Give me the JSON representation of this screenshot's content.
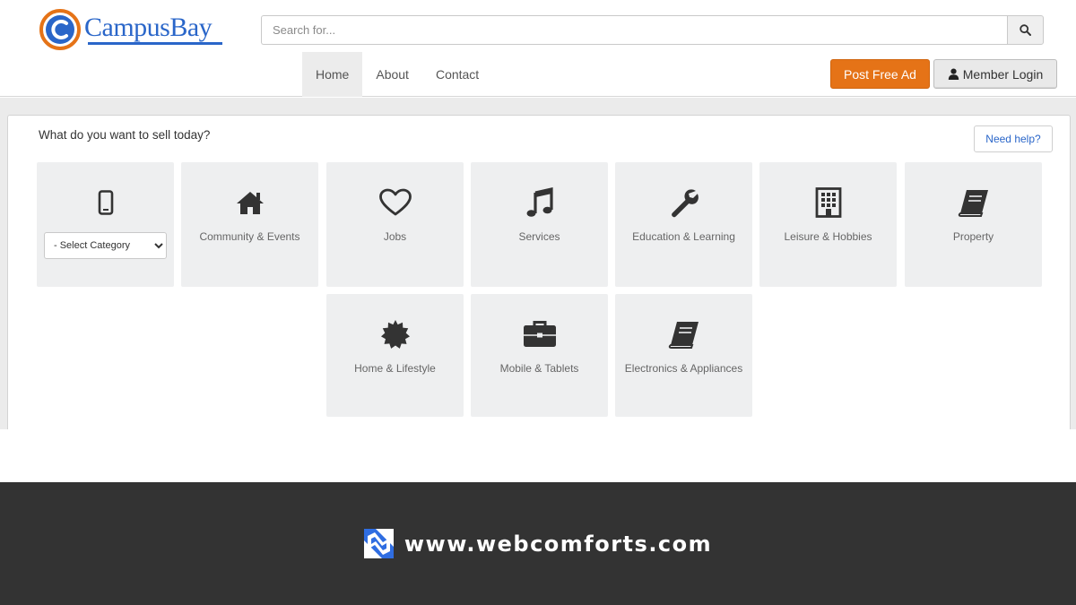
{
  "brand": {
    "logo_text": "CampusBay",
    "accent_color": "#2a66c9",
    "orange_color": "#e57317"
  },
  "search": {
    "placeholder": "Search for...",
    "icon": "search-icon"
  },
  "nav": {
    "items": [
      {
        "label": "Home",
        "active": true
      },
      {
        "label": "About",
        "active": false
      },
      {
        "label": "Contact",
        "active": false
      }
    ]
  },
  "actions": {
    "post_ad_label": "Post Free Ad",
    "member_login_label": "Member Login",
    "member_login_icon": "user-icon"
  },
  "panel": {
    "title": "What do you want to sell today?",
    "help_label": "Need help?"
  },
  "select_category": {
    "icon": "mobile-phone-icon",
    "selected": "- Select Category"
  },
  "categories": [
    {
      "label": "Community & Events",
      "icon": "home-icon"
    },
    {
      "label": "Jobs",
      "icon": "heart-icon"
    },
    {
      "label": "Services",
      "icon": "music-icon"
    },
    {
      "label": "Education & Learning",
      "icon": "wrench-icon"
    },
    {
      "label": "Leisure & Hobbies",
      "icon": "building-icon"
    },
    {
      "label": "Property",
      "icon": "book-icon"
    },
    {
      "label": "Home & Lifestyle",
      "icon": "badge-icon"
    },
    {
      "label": "Mobile & Tablets",
      "icon": "briefcase-icon"
    },
    {
      "label": "Electronics & Appliances",
      "icon": "book-icon"
    }
  ],
  "footer": {
    "text": "www.webcomforts.com"
  }
}
